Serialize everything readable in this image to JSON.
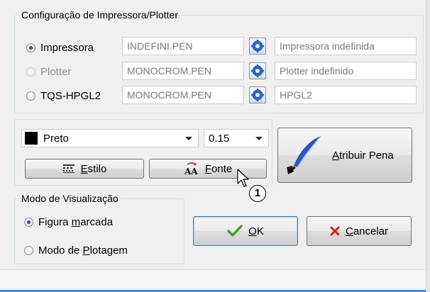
{
  "printer_group": {
    "legend": "Configuração de Impressora/Plotter",
    "rows": [
      {
        "label": "Impressora",
        "checked": true,
        "disabled": false,
        "pen_file": "INDEFINI.PEN",
        "device": "Impressora indefinida"
      },
      {
        "label": "Plotter",
        "checked": false,
        "disabled": true,
        "pen_file": "MONOCROM.PEN",
        "device": "Plotter indefinido"
      },
      {
        "label": "TQS-HPGL2",
        "checked": false,
        "disabled": false,
        "pen_file": "MONOCROM.PEN",
        "device": "HPGL2"
      }
    ]
  },
  "pen": {
    "color_name": "Preto",
    "color_hex": "#000000",
    "thickness": "0.15",
    "style_button": {
      "before": "",
      "key": "E",
      "after": "stilo"
    },
    "font_button": {
      "before": "",
      "key": "F",
      "after": "onte"
    },
    "assign_button": {
      "before": "",
      "key": "A",
      "after": "tribuir Pena"
    }
  },
  "view_group": {
    "legend": "Modo de Visualização",
    "options": [
      {
        "before": "Figura ",
        "key": "m",
        "after": "arcada",
        "checked": true
      },
      {
        "before": "Modo de ",
        "key": "P",
        "after": "lotagem",
        "checked": false
      }
    ]
  },
  "actions": {
    "ok": {
      "before": "",
      "key": "O",
      "after": "K"
    },
    "cancel": {
      "before": "",
      "key": "C",
      "after": "ancelar"
    }
  },
  "annotation": {
    "callout": "1"
  },
  "colors": {
    "accent_check": "#3aa51f",
    "cancel_x": "#d42020",
    "radio_dot": "#1b50b9"
  }
}
